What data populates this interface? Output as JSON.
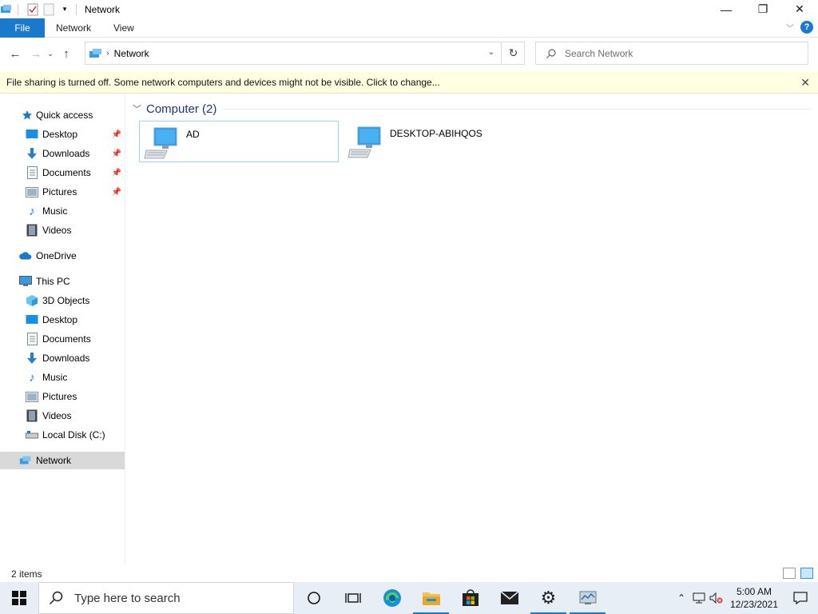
{
  "window": {
    "title": "Network",
    "controls": {
      "minimize": "—",
      "maximize": "❐",
      "close": "✕"
    }
  },
  "ribbon": {
    "tabs": [
      {
        "label": "File"
      },
      {
        "label": "Network"
      },
      {
        "label": "View"
      }
    ],
    "help": "?"
  },
  "address": {
    "crumbs": [
      "Network"
    ],
    "refresh_glyph": "↻"
  },
  "search": {
    "placeholder": "Search Network"
  },
  "infobar": {
    "message": "File sharing is turned off. Some network computers and devices might not be visible. Click to change..."
  },
  "nav": {
    "quick_access": {
      "label": "Quick access",
      "items": [
        {
          "label": "Desktop",
          "icon": "desktop-icon",
          "pinned": true
        },
        {
          "label": "Downloads",
          "icon": "downloads-icon",
          "pinned": true
        },
        {
          "label": "Documents",
          "icon": "documents-icon",
          "pinned": true
        },
        {
          "label": "Pictures",
          "icon": "pictures-icon",
          "pinned": true
        },
        {
          "label": "Music",
          "icon": "music-icon",
          "pinned": false
        },
        {
          "label": "Videos",
          "icon": "videos-icon",
          "pinned": false
        }
      ]
    },
    "onedrive": {
      "label": "OneDrive"
    },
    "this_pc": {
      "label": "This PC",
      "items": [
        {
          "label": "3D Objects",
          "icon": "3d-objects-icon"
        },
        {
          "label": "Desktop",
          "icon": "desktop-icon"
        },
        {
          "label": "Documents",
          "icon": "documents-icon"
        },
        {
          "label": "Downloads",
          "icon": "downloads-icon"
        },
        {
          "label": "Music",
          "icon": "music-icon"
        },
        {
          "label": "Pictures",
          "icon": "pictures-icon"
        },
        {
          "label": "Videos",
          "icon": "videos-icon"
        },
        {
          "label": "Local Disk (C:)",
          "icon": "drive-icon"
        }
      ]
    },
    "network": {
      "label": "Network",
      "selected": true
    }
  },
  "content": {
    "group": {
      "label": "Computer (2)"
    },
    "computers": [
      {
        "name": "AD",
        "selected": true
      },
      {
        "name": "DESKTOP-ABIHQOS",
        "selected": false
      }
    ]
  },
  "status": {
    "items_count": "2 items"
  },
  "taskbar": {
    "search_placeholder": "Type here to search",
    "apps": [
      {
        "name": "cortana-icon"
      },
      {
        "name": "task-view-icon"
      },
      {
        "name": "edge-icon"
      },
      {
        "name": "file-explorer-icon",
        "active": true
      },
      {
        "name": "store-icon"
      },
      {
        "name": "mail-icon"
      },
      {
        "name": "settings-icon",
        "active": true
      },
      {
        "name": "server-manager-icon",
        "active": true
      }
    ],
    "clock": {
      "time": "5:00 AM",
      "date": "12/23/2021"
    }
  },
  "colors": {
    "accent": "#1979ca",
    "infobar": "#ffffe1",
    "selected_nav": "#d9d9d9",
    "group_header": "#1e3287"
  }
}
